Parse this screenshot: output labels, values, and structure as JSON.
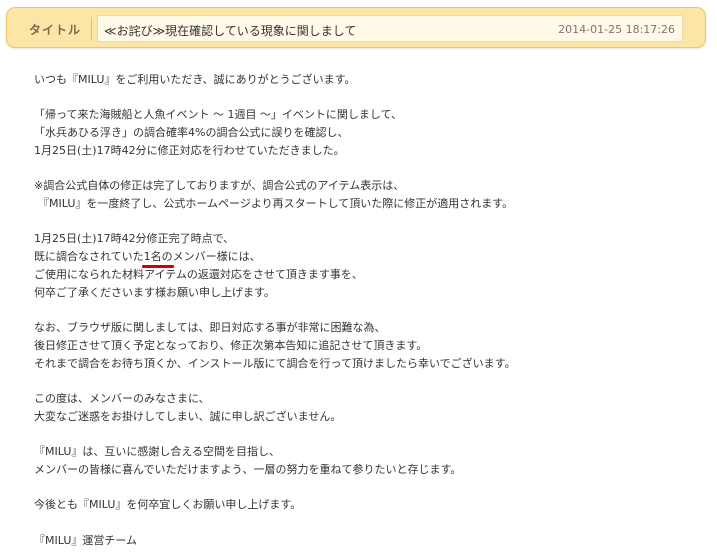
{
  "header": {
    "label": "タイトル",
    "title": "≪お詫び≫現在確認している現象に関しまして",
    "date": "2014-01-25 18:17:26"
  },
  "body": {
    "p1": [
      "いつも『MILU』をご利用いただき、誠にありがとうございます。"
    ],
    "p2": [
      "「帰って来た海賊船と人魚イベント 〜 1週目 〜」イベントに関しまして、",
      "「水兵あひる浮き」の調合確率4%の調合公式に誤りを確認し、",
      "1月25日(土)17時42分に修正対応を行わせていただきました。"
    ],
    "p3": [
      "※調合公式自体の修正は完了しておりますが、調合公式のアイテム表示は、",
      "『MILU』を一度終了し、公式ホームページより再スタートして頂いた際に修正が適用されます。"
    ],
    "p4": {
      "line1": "1月25日(土)17時42分修正完了時点で、",
      "line2_before": "既に調合なされていた",
      "line2_highlight": "1名の",
      "line2_after": "メンバー様には、",
      "line3": "ご使用になられた材料アイテムの返還対応をさせて頂きます事を、",
      "line4": "何卒ご了承くださいます様お願い申し上げます。"
    },
    "p5": [
      "なお、ブラウザ版に関しましては、即日対応する事が非常に困難な為、",
      "後日修正させて頂く予定となっており、修正次第本告知に追記させて頂きます。",
      "それまで調合をお待ち頂くか、インストール版にて調合を行って頂けましたら幸いでございます。"
    ],
    "p6": [
      "この度は、メンバーのみなさまに、",
      "大変なご迷惑をお掛けしてしまい、誠に申し訳ございません。"
    ],
    "p7": [
      "『MILU』は、互いに感謝し合える空間を目指し、",
      "メンバーの皆様に喜んでいただけますよう、一層の努力を重ねて参りたいと存じます。"
    ],
    "p8": [
      "今後とも『MILU』を何卒宜しくお願い申し上げます。"
    ],
    "signature": "『MILU』運営チーム"
  },
  "colors": {
    "header_bg": "#fbe5a7",
    "header_border": "#f0c56a",
    "highlight_underline": "#d40000"
  }
}
